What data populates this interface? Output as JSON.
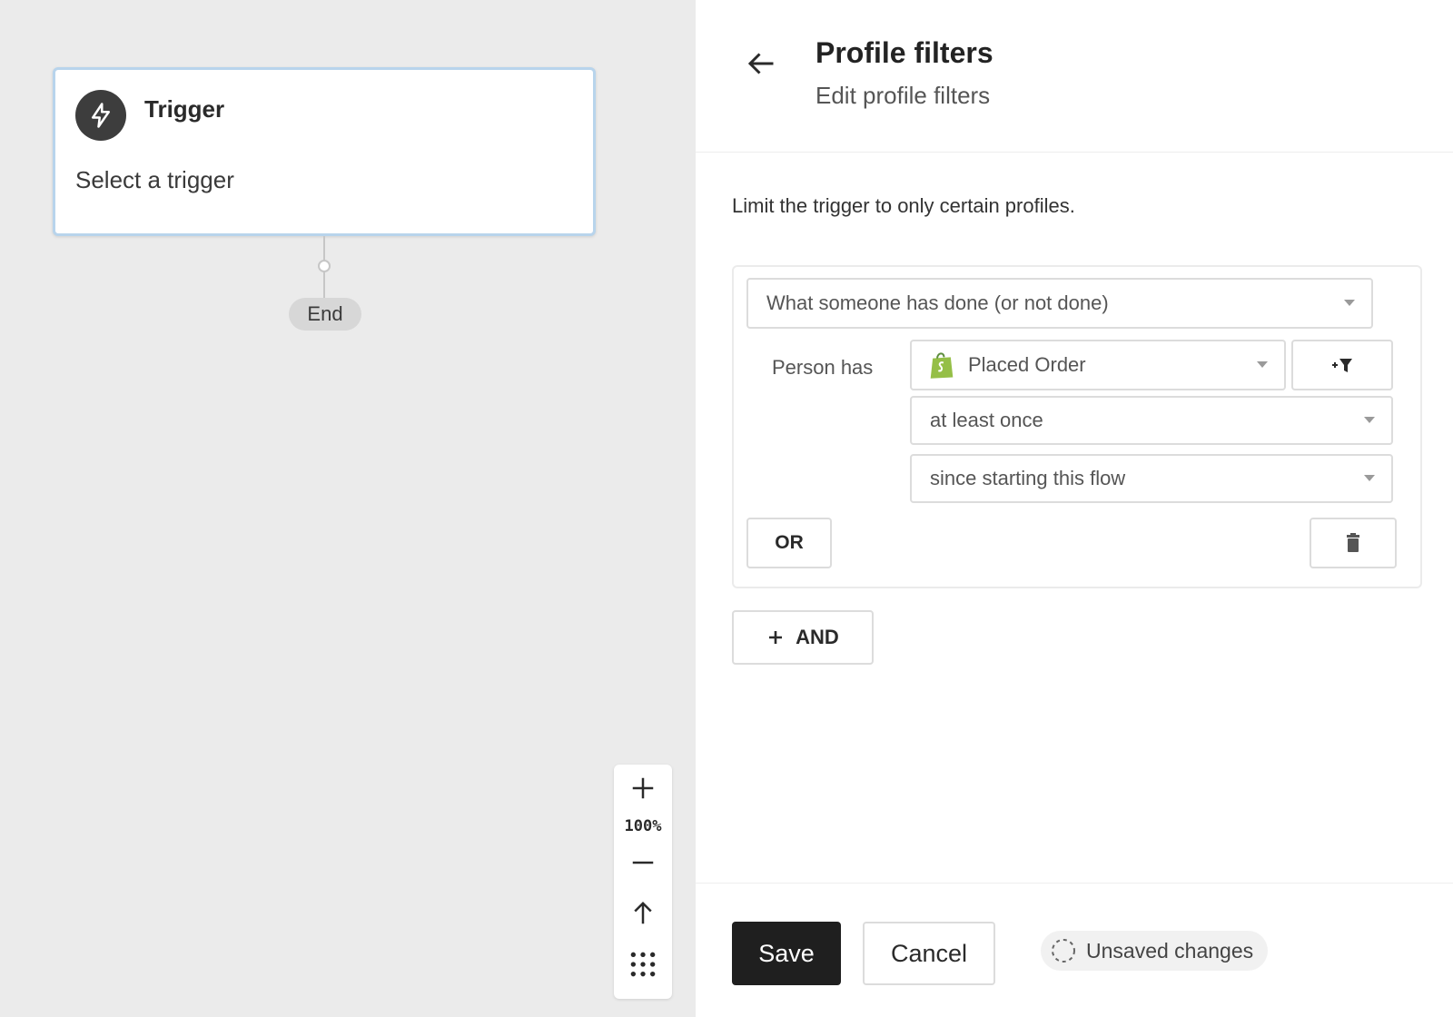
{
  "canvas": {
    "trigger_card": {
      "title": "Trigger",
      "subtitle": "Select a trigger",
      "icon": "lightning-bolt-icon"
    },
    "end_label": "End",
    "zoom": {
      "level": "100%",
      "zoom_in_icon": "plus-icon",
      "zoom_out_icon": "minus-icon",
      "recenter_icon": "arrow-up-icon",
      "grid_icon": "grid-dots-icon"
    }
  },
  "panel": {
    "back_icon": "arrow-left-icon",
    "title": "Profile filters",
    "subtitle": "Edit profile filters",
    "description": "Limit the trigger to only certain profiles.",
    "filter": {
      "condition_type": "What someone has done (or not done)",
      "person_has_label": "Person has",
      "metric": "Placed Order",
      "metric_icon": "shopify-bag-icon",
      "add_filter_icon": "add-filter-icon",
      "frequency": "at least once",
      "timeframe": "since starting this flow",
      "or_label": "OR",
      "delete_icon": "trash-icon"
    },
    "and_label": "AND",
    "footer": {
      "save_label": "Save",
      "cancel_label": "Cancel",
      "unsaved_label": "Unsaved changes"
    }
  },
  "colors": {
    "canvas_bg": "#ebebeb",
    "card_border": "#b8d4ec",
    "primary_button": "#1f1f1f",
    "shopify_green": "#95bf47"
  }
}
